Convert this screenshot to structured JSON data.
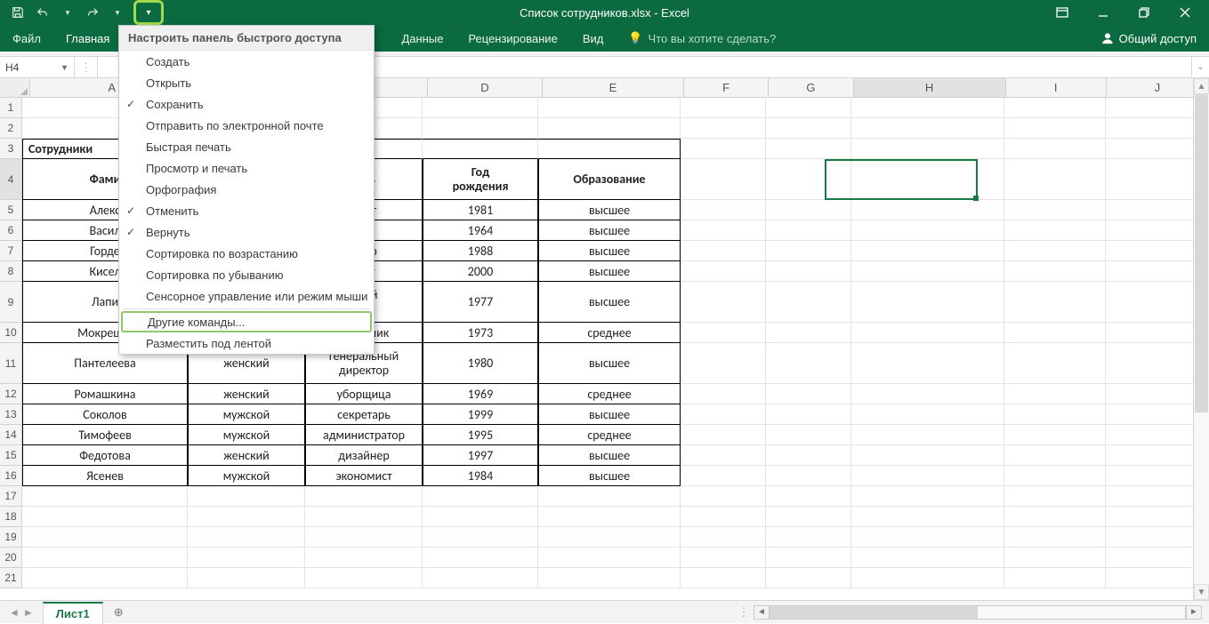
{
  "app": {
    "title": "Список сотрудников.xlsx - Excel"
  },
  "ribbon": {
    "file": "Файл",
    "home": "Главная",
    "data": "Данные",
    "review": "Рецензирование",
    "view": "Вид",
    "tellme": "Что вы хотите сделать?",
    "share": "Общий доступ"
  },
  "namebox": "H4",
  "formula": "",
  "qat_menu": {
    "title": "Настроить панель быстрого доступа",
    "items": [
      {
        "label": "Создать",
        "checked": false
      },
      {
        "label": "Открыть",
        "checked": false
      },
      {
        "label": "Сохранить",
        "checked": true
      },
      {
        "label": "Отправить по электронной почте",
        "checked": false
      },
      {
        "label": "Быстрая печать",
        "checked": false
      },
      {
        "label": "Просмотр и печать",
        "checked": false
      },
      {
        "label": "Орфография",
        "checked": false
      },
      {
        "label": "Отменить",
        "checked": true
      },
      {
        "label": "Вернуть",
        "checked": true
      },
      {
        "label": "Сортировка по возрастанию",
        "checked": false
      },
      {
        "label": "Сортировка по убыванию",
        "checked": false
      },
      {
        "label": "Сенсорное управление или режим мыши",
        "checked": false
      }
    ],
    "more": "Другие команды...",
    "below": "Разместить под лентой"
  },
  "columns": [
    "A",
    "D",
    "E",
    "F",
    "G",
    "H",
    "I",
    "J"
  ],
  "col_widths": {
    "A": 186,
    "B_hidden_partial": 134,
    "C_hidden_partial": 132,
    "D": 130,
    "E": 160,
    "F": 96,
    "G": 96,
    "H": 172,
    "I": 114,
    "J": 116
  },
  "table": {
    "r3_a": "Сотрудники",
    "headers": {
      "a": "Фами",
      "c": "ость",
      "d": "Год рождения",
      "e": "Образование"
    },
    "rows": [
      {
        "a": "Алекс",
        "c": "мист",
        "d": "1981",
        "e": "высшее"
      },
      {
        "a": "Васил",
        "c": "тер",
        "d": "1964",
        "e": "высшее"
      },
      {
        "a": "Горде",
        "c": "йнер",
        "d": "1988",
        "e": "высшее"
      },
      {
        "a": "Кисел",
        "c": "тант",
        "d": "2000",
        "e": "высшее"
      },
      {
        "a": "Лапи",
        "c": "овый\nтор",
        "d": "1977",
        "e": "высшее",
        "tall": true
      },
      {
        "a": "Мокрецов",
        "b": "мужской",
        "c": "охранник",
        "d": "1973",
        "e": "среднее"
      },
      {
        "a": "Пантелеева",
        "b": "женский",
        "c": "генеральный директор",
        "d": "1980",
        "e": "высшее",
        "tall": true
      },
      {
        "a": "Ромашкина",
        "b": "женский",
        "c": "уборщица",
        "d": "1969",
        "e": "среднее"
      },
      {
        "a": "Соколов",
        "b": "мужской",
        "c": "секретарь",
        "d": "1999",
        "e": "высшее"
      },
      {
        "a": "Тимофеев",
        "b": "мужской",
        "c": "администратор",
        "d": "1995",
        "e": "среднее"
      },
      {
        "a": "Федотова",
        "b": "женский",
        "c": "дизайнер",
        "d": "1997",
        "e": "высшее"
      },
      {
        "a": "Ясенев",
        "b": "мужской",
        "c": "экономист",
        "d": "1984",
        "e": "высшее"
      }
    ]
  },
  "sheet": {
    "name": "Лист1"
  },
  "row_numbers": [
    "1",
    "2",
    "3",
    "4",
    "5",
    "6",
    "7",
    "8",
    "9",
    "10",
    "11",
    "12",
    "13",
    "14",
    "15",
    "16",
    "17",
    "18",
    "19",
    "20",
    "21"
  ]
}
